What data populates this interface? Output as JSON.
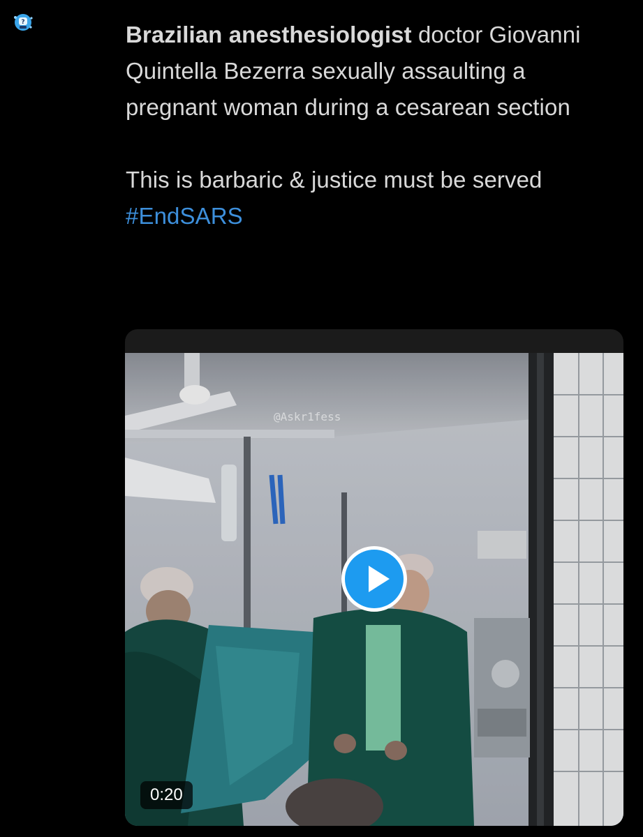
{
  "tweet": {
    "avatar_icon": "robot-avatar-icon",
    "text_bold": "Brazilian anesthesiologist",
    "text_rest": " doctor Giovanni Quintella Bezerra sexually assaulting a pregnant woman during a cesarean section",
    "text_second": "This is barbaric & justice must be served",
    "hashtag": "#EndSARS"
  },
  "media": {
    "watermark": "@Askr1fess",
    "play_icon": "play-icon",
    "duration": "0:20"
  },
  "colors": {
    "background": "#000000",
    "text": "#d9d9d9",
    "hashtag": "#3d8fdb",
    "play_button": "#1d9bf0"
  }
}
